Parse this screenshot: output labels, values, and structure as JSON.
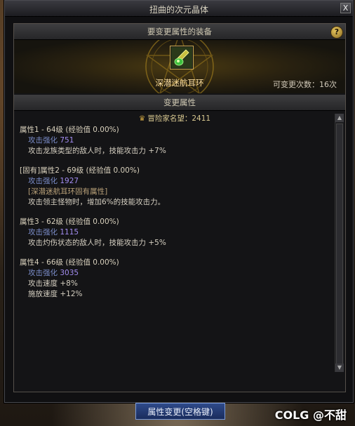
{
  "window": {
    "title": "扭曲的次元晶体",
    "close_label": "X"
  },
  "equip_section": {
    "header": "要变更属性的装备",
    "help_label": "?",
    "item_name": "深潜迷航耳环",
    "change_count": "可变更次数：16次"
  },
  "attr_section": {
    "header": "变更属性",
    "adventurer_fame": "冒险家名望：2411",
    "attributes": [
      {
        "head": "属性1 - 64级 (经验值 0.00%)",
        "atk_label": "攻击强化 ",
        "atk_value": "751",
        "lines": [
          "攻击龙族类型的敌人时，技能攻击力 +7%"
        ]
      },
      {
        "head": "[固有]属性2 - 69级 (经验值 0.00%)",
        "atk_label": "攻击强化 ",
        "atk_value": "1927",
        "inherent": "[深潜迷航耳环固有属性]",
        "lines": [
          "攻击领主怪物时，增加6%的技能攻击力。"
        ]
      },
      {
        "head": "属性3 - 62级 (经验值 0.00%)",
        "atk_label": "攻击强化 ",
        "atk_value": "1115",
        "lines": [
          "攻击灼伤状态的敌人时，技能攻击力 +5%"
        ]
      },
      {
        "head": "属性4 - 66级 (经验值 0.00%)",
        "atk_label": "攻击强化 ",
        "atk_value": "3035",
        "lines": [
          "攻击速度 +8%",
          "施放速度 +12%"
        ]
      }
    ]
  },
  "footer": {
    "change_button": "属性变更(空格键)",
    "watermark": "COLG @不甜"
  },
  "icons": {
    "item": "earring-icon",
    "fame": "fame-crown-icon",
    "help": "help-icon",
    "close": "close-icon"
  },
  "colors": {
    "item_border": "#c8a850",
    "attack_value": "#a28cf0",
    "button_blue": "#2e4a8a"
  }
}
